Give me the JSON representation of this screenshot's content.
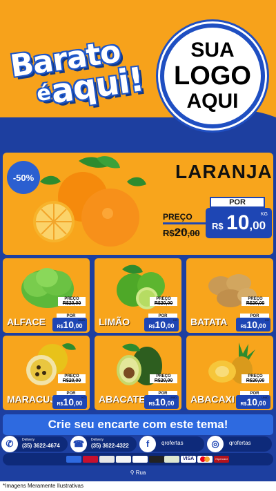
{
  "brand": {
    "line1": "Barato",
    "line2_e": "é",
    "line2": "aqui!"
  },
  "logo": {
    "line1": "SUA",
    "line2": "LOGO",
    "line3": "AQUI"
  },
  "featured": {
    "discount": "-50%",
    "name": "LARANJA",
    "old_label": "PREÇO",
    "old_currency": "R$",
    "old_int": "20",
    "old_dec": ",00",
    "new_label": "POR",
    "new_currency": "R$",
    "new_int": "10",
    "new_dec": ",00",
    "unit": "KG"
  },
  "products": [
    {
      "name": "ALFACE",
      "old_label": "PREÇO",
      "old": "R$20,00",
      "por": "POR",
      "cur": "R$",
      "int": "10",
      "dec": ",00",
      "unit": "UNID."
    },
    {
      "name": "LIMÃO",
      "old_label": "PREÇO",
      "old": "R$20,00",
      "por": "POR",
      "cur": "R$",
      "int": "10",
      "dec": ",00",
      "unit": "KG"
    },
    {
      "name": "BATATA",
      "old_label": "PREÇO",
      "old": "R$20,00",
      "por": "POR",
      "cur": "R$",
      "int": "10",
      "dec": ",00",
      "unit": "KG"
    },
    {
      "name": "MARACUJÁ",
      "old_label": "PREÇO",
      "old": "R$20,00",
      "por": "POR",
      "cur": "R$",
      "int": "10",
      "dec": ",00",
      "unit": "KG"
    },
    {
      "name": "ABACATE",
      "old_label": "PREÇO",
      "old": "R$20,00",
      "por": "POR",
      "cur": "R$",
      "int": "10",
      "dec": ",00",
      "unit": "UNID."
    },
    {
      "name": "ABACAXI",
      "old_label": "PREÇO",
      "old": "R$20,00",
      "por": "POR",
      "cur": "R$",
      "int": "10",
      "dec": ",00",
      "unit": "UNID."
    }
  ],
  "cta": "Crie seu encarte com este tema!",
  "contacts": {
    "whatsapp": {
      "label": "Delivery",
      "phone": "(35) 3622-4674"
    },
    "phone": {
      "label": "Delivery",
      "phone": "(35) 3622-4322"
    },
    "facebook": "qrofertas",
    "instagram": "qrofertas"
  },
  "payments": [
    "card",
    "card",
    "card",
    "card",
    "card",
    "card",
    "card",
    "VISA",
    "mastercard",
    "Hipercard"
  ],
  "address": "Rua",
  "disclaimer": "*Imagens Meramente Ilustrativas",
  "colors": {
    "orange": "#f7a21b",
    "blue": "#1d3fa0",
    "accent_blue": "#2e6ae0",
    "dark_blue": "#0e2a7a"
  }
}
